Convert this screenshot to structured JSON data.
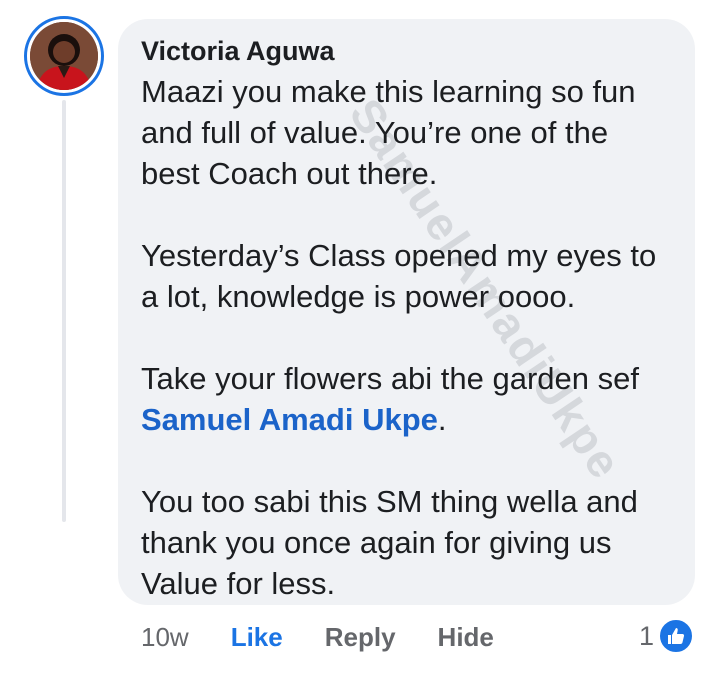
{
  "comment": {
    "author": "Victoria Aguwa",
    "paragraphs": [
      "Maazi you make this learning so fun and full of value. You’re one of the best Coach out there.",
      "Yesterday’s Class opened my eyes to a lot, knowledge is power oooo."
    ],
    "para3_before": "Take your flowers abi the garden sef ",
    "mention": "Samuel Amadi Ukpe",
    "para3_after": ".",
    "paragraph4": "You too sabi this SM thing wella and thank you once again for giving us Value for less.",
    "watermark": "SamuelAmadiUkpe"
  },
  "actions": {
    "time": "10w",
    "like": "Like",
    "reply": "Reply",
    "hide": "Hide"
  },
  "reactions": {
    "count": "1",
    "icon": "thumbs-up-icon"
  },
  "colors": {
    "accent": "#1b74e4",
    "bubble": "#f0f2f5",
    "muted": "#65676b"
  }
}
